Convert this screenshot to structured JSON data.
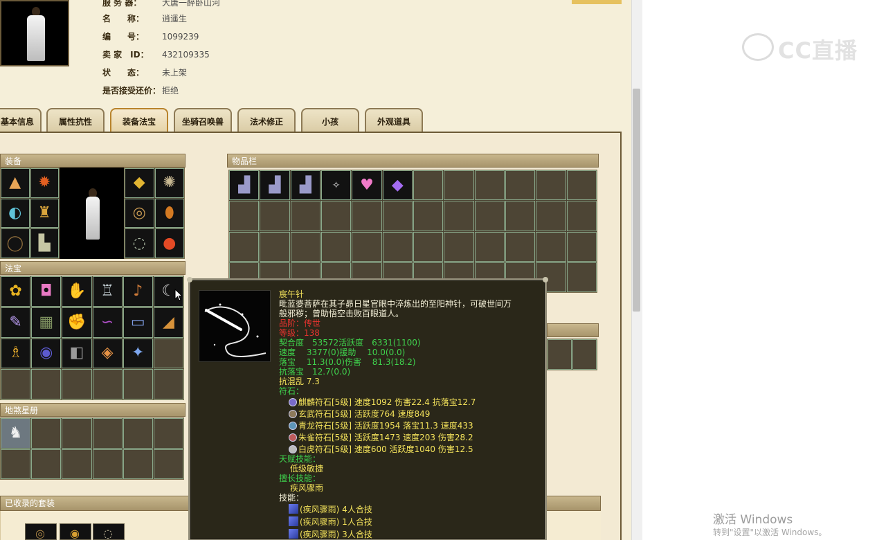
{
  "info": {
    "server_label": "服 务 器：",
    "server_value": "大唐一醉卧山河",
    "name_label": "名　　称：",
    "name_value": "逍遥生",
    "id_label": "编　　号：",
    "id_value": "1099239",
    "seller_label": "卖 家　ID：",
    "seller_value": "432109335",
    "status_label": "状　　态：",
    "status_value": "未上架",
    "bargain_label": "是否接受还价：",
    "bargain_value": "拒绝"
  },
  "tabs": [
    {
      "label": "基本信息"
    },
    {
      "label": "属性抗性"
    },
    {
      "label": "装备法宝"
    },
    {
      "label": "坐骑召唤兽"
    },
    {
      "label": "法术修正"
    },
    {
      "label": "小孩"
    },
    {
      "label": "外观道具"
    }
  ],
  "active_tab": "装备法宝",
  "sections": {
    "equipment": "装备",
    "fabao": "法宝",
    "inventory": "物品栏",
    "dishaxingce": "地煞星册",
    "suits": "已收录的套装"
  },
  "tooltip": {
    "name": "宸午针",
    "desc1": "毗蓝婆菩萨在其子昴日星官眼中淬炼出的至阳神针，可破世间万",
    "desc2": "般邪秽；曾助悟空击败百眼道人。",
    "quality": "品阶：传世",
    "level": "等级：138",
    "line1": "契合度　53572活跃度　6331(1100)",
    "line2": "速度　 3377(0)援助　 10.0(0.0)",
    "line3": "落宝　 11.3(0.0)伤害　 81.3(18.2)",
    "line4": "抗落宝　12.7(0.0)",
    "line5": "抗混乱 7.3",
    "runes_label": "符石：",
    "runes": [
      "麒麟符石[5级] 速度1092 伤害22.4 抗落宝12.7",
      "玄武符石[5级] 活跃度764 速度849",
      "青龙符石[5级] 活跃度1954 落宝11.3 速度433",
      "朱雀符石[5级] 活跃度1473 速度203 伤害28.2",
      "白虎符石[5级] 速度600 活跃度1040 伤害12.5"
    ],
    "talent_label": "天赋技能：",
    "talent_value": "低级敏捷",
    "expert_label": "擅长技能：",
    "expert_value": "疾风骤雨",
    "skill_label": "技能：",
    "skills": [
      "(疾风骤雨) 4人合技",
      "(疾风骤雨) 1人合技",
      "(疾风骤雨) 3人合技"
    ]
  },
  "watermark": {
    "logo_text": "CC直播",
    "windows_title": "激活 Windows",
    "windows_sub": "转到\"设置\"以激活 Windows。"
  },
  "colors": {
    "tooltip_bg": "#2a2719",
    "quality_red": "#e8332f",
    "stat_green": "#3fd24d",
    "title_yellow": "#f3e25b",
    "page_bg": "#f5efd9"
  }
}
